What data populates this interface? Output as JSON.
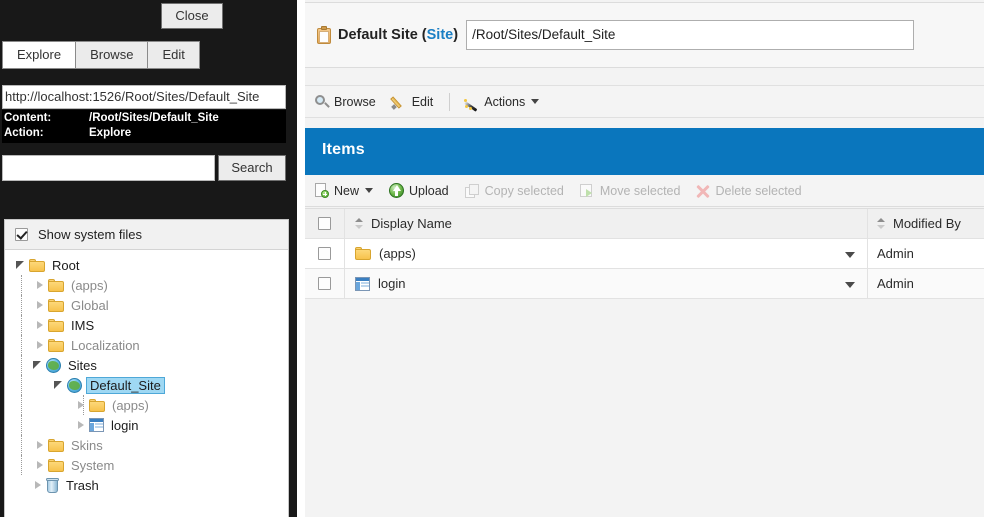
{
  "left_panel": {
    "close_label": "Close",
    "tabs": [
      {
        "label": "Explore",
        "active": true
      },
      {
        "label": "Browse",
        "active": false
      },
      {
        "label": "Edit",
        "active": false
      }
    ],
    "url_value": "http://localhost:1526/Root/Sites/Default_Site",
    "info": {
      "content_key": "Content:",
      "content_value": "/Root/Sites/Default_Site",
      "action_key": "Action:",
      "action_value": "Explore"
    },
    "search": {
      "value": "",
      "placeholder": "",
      "button_label": "Search"
    },
    "system_files": {
      "label": "Show system files",
      "checked": true
    },
    "tree": [
      {
        "label": "Root",
        "icon": "folder-icon",
        "depth": 0,
        "state": "expanded",
        "selected": false,
        "muted": false
      },
      {
        "label": "(apps)",
        "icon": "folder-icon",
        "depth": 1,
        "state": "collapsed",
        "selected": false,
        "muted": true
      },
      {
        "label": "Global",
        "icon": "folder-icon",
        "depth": 1,
        "state": "collapsed",
        "selected": false,
        "muted": true
      },
      {
        "label": "IMS",
        "icon": "folder-icon",
        "depth": 1,
        "state": "collapsed",
        "selected": false,
        "muted": false
      },
      {
        "label": "Localization",
        "icon": "folder-icon",
        "depth": 1,
        "state": "collapsed",
        "selected": false,
        "muted": true
      },
      {
        "label": "Sites",
        "icon": "globe-icon",
        "depth": 1,
        "state": "expanded",
        "selected": false,
        "muted": false
      },
      {
        "label": "Default_Site",
        "icon": "globe-icon",
        "depth": 2,
        "state": "expanded",
        "selected": true,
        "muted": false
      },
      {
        "label": "(apps)",
        "icon": "folder-icon",
        "depth": 3,
        "state": "collapsed",
        "selected": false,
        "muted": true
      },
      {
        "label": "login",
        "icon": "page-icon",
        "depth": 3,
        "state": "collapsed",
        "selected": false,
        "muted": false
      },
      {
        "label": "Skins",
        "icon": "folder-icon",
        "depth": 1,
        "state": "collapsed",
        "selected": false,
        "muted": true
      },
      {
        "label": "System",
        "icon": "folder-icon",
        "depth": 1,
        "state": "collapsed",
        "selected": false,
        "muted": true
      },
      {
        "label": "Trash",
        "icon": "trash-icon",
        "depth": 1,
        "state": "collapsed",
        "selected": false,
        "muted": false
      }
    ]
  },
  "content": {
    "header": {
      "icon": "clipboard-icon",
      "title": "Default Site",
      "type_open": "(",
      "type": "Site",
      "type_close": ")",
      "path_value": "/Root/Sites/Default_Site"
    },
    "action_bar": [
      {
        "label": "Browse",
        "icon": "magnifier-icon",
        "caret": false,
        "disabled": false
      },
      {
        "label": "Edit",
        "icon": "pencil-icon",
        "caret": false,
        "disabled": false
      },
      {
        "label": "Actions",
        "icon": "wand-icon",
        "caret": true,
        "disabled": false
      }
    ],
    "items_panel": {
      "title": "Items",
      "accent_color": "#0a76bd",
      "toolbar": [
        {
          "label": "New",
          "icon": "new-document-icon",
          "caret": true,
          "disabled": false
        },
        {
          "label": "Upload",
          "icon": "upload-icon",
          "caret": false,
          "disabled": false
        },
        {
          "label": "Copy selected",
          "icon": "copy-icon",
          "caret": false,
          "disabled": true
        },
        {
          "label": "Move selected",
          "icon": "move-icon",
          "caret": false,
          "disabled": true
        },
        {
          "label": "Delete selected",
          "icon": "delete-icon",
          "caret": false,
          "disabled": true
        }
      ],
      "columns": [
        {
          "label": "Display Name",
          "sortable": true
        },
        {
          "label": "Modified By",
          "sortable": true
        }
      ],
      "rows": [
        {
          "checked": false,
          "icon": "folder-icon",
          "display_name": "(apps)",
          "modified_by": "Admin"
        },
        {
          "checked": false,
          "icon": "page-icon",
          "display_name": "login",
          "modified_by": "Admin"
        }
      ]
    }
  }
}
